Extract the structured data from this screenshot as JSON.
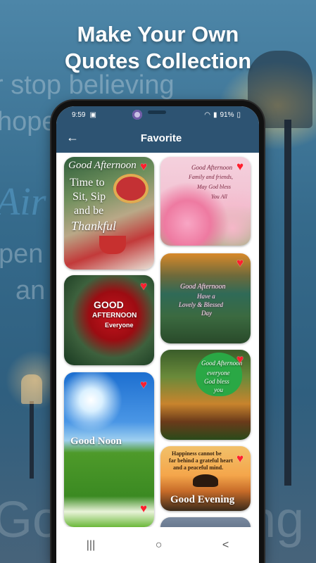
{
  "headline": {
    "line1": "Make Your Own",
    "line2": "Quotes Collection"
  },
  "background_text": {
    "line1": "r stop believing",
    "line2": "hope",
    "line3": "Air",
    "line4": "pen",
    "line5": "an",
    "line6": "Go",
    "line7": "ng"
  },
  "status_bar": {
    "time": "9:59",
    "battery": "91%"
  },
  "app_bar": {
    "title": "Favorite",
    "back_icon": "arrow-left-icon"
  },
  "cards": [
    {
      "id": "good-afternoon-tea",
      "title": "Good Afternoon",
      "text1": "Time to",
      "text2": "Sit, Sip",
      "text3": "and be",
      "text4": "Thankful",
      "favorite": true
    },
    {
      "id": "good-afternoon-roses",
      "title": "Good Afternoon",
      "text1": "Family and friends,",
      "text2": "May God bless",
      "text3": "You All",
      "favorite": true
    },
    {
      "id": "good-afternoon-heart",
      "text1": "GOOD",
      "text2": "AFTERNOON",
      "text3": "Everyone",
      "favorite": true
    },
    {
      "id": "good-afternoon-lake",
      "title": "Good Afternoon",
      "text1": "Have a",
      "text2": "Lovely & Blessed",
      "text3": "Day",
      "favorite": true
    },
    {
      "id": "good-afternoon-tiger",
      "text1": "Good Afternoon",
      "text2": "everyone",
      "text3": "God bless",
      "text4": "you",
      "favorite": true
    },
    {
      "id": "good-noon",
      "text1": "Good Noon",
      "favorite": true
    },
    {
      "id": "good-evening",
      "text1": "Happiness cannot be",
      "text2": "far behind a grateful heart",
      "text3": "and a peaceful mind.",
      "text4": "Good Evening",
      "favorite": true
    }
  ],
  "nav_bar": {
    "recents": "|||",
    "home": "○",
    "back": "<"
  },
  "colors": {
    "primary": "#2d5372",
    "heart": "#ff1f2e"
  }
}
